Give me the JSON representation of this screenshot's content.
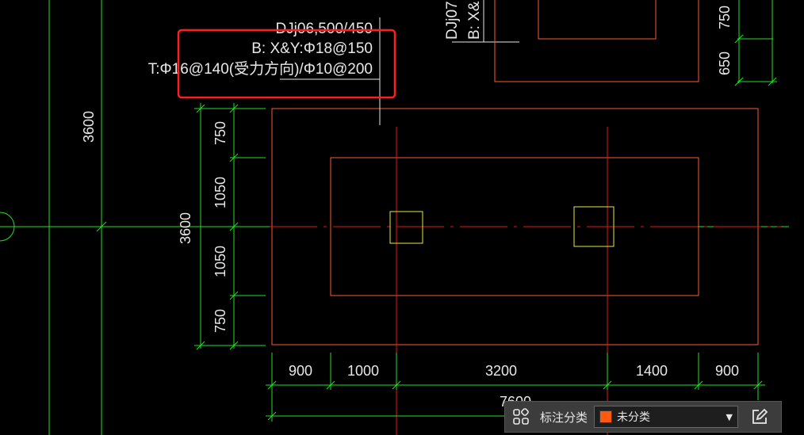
{
  "drawing": {
    "labels": {
      "dj06_line1": "DJj06,500/450",
      "dj06_line2": "B: X&Y:Φ18@150",
      "dj06_line3": "T:Φ16@140(受力方向)/Φ10@200",
      "dj07_line1": "DJj07",
      "dj07_line2": "B: X&"
    },
    "dimensions": {
      "left_3600": "3600",
      "mid_3600": "3600",
      "v750a": "750",
      "v1050a": "1050",
      "v1050b": "1050",
      "v750b": "750",
      "top_750": "750",
      "top_650": "650",
      "h900a": "900",
      "h1000": "1000",
      "h3200": "3200",
      "h1400": "1400",
      "h900b": "900",
      "total_7600": "7600"
    }
  },
  "toolbar": {
    "label": "标注分类",
    "selected": "未分类",
    "swatch_color": "#ff5a10"
  }
}
